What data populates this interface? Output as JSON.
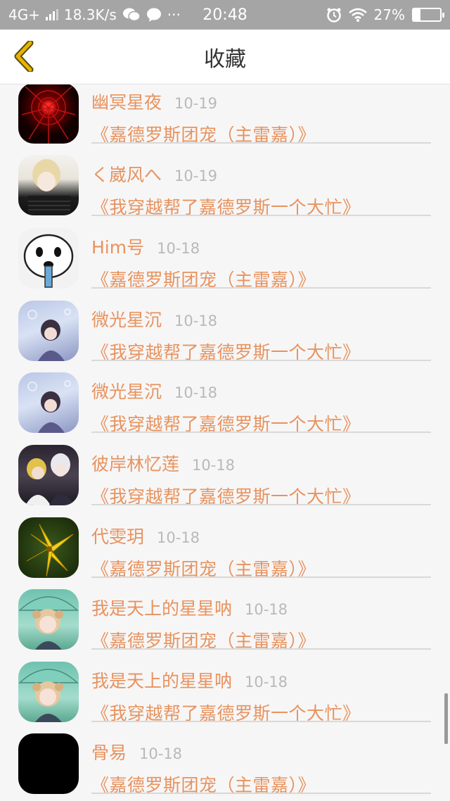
{
  "status_bar": {
    "network": "4G+",
    "speed": "18.3K/s",
    "more": "···",
    "time": "20:48",
    "battery": "27%",
    "battery_level": 0.27
  },
  "nav": {
    "title": "收藏"
  },
  "favorites": [
    {
      "user": "幽冥星夜",
      "date": "10-19",
      "book": "《嘉德罗斯团宠（主雷嘉）》",
      "avatar": "red-web-avatar"
    },
    {
      "user": "く崴风へ",
      "date": "10-19",
      "book": "《我穿越帮了嘉德罗斯一个大忙》",
      "avatar": "anime-boy-avatar"
    },
    {
      "user": "Him号",
      "date": "10-18",
      "book": "《嘉德罗斯团宠（主雷嘉）》",
      "avatar": "meme-face-avatar"
    },
    {
      "user": "微光星沉",
      "date": "10-18",
      "book": "《我穿越帮了嘉德罗斯一个大忙》",
      "avatar": "anime-girl-avatar"
    },
    {
      "user": "微光星沉",
      "date": "10-18",
      "book": "《我穿越帮了嘉德罗斯一个大忙》",
      "avatar": "anime-girl-avatar"
    },
    {
      "user": "彼岸林忆莲",
      "date": "10-18",
      "book": "《我穿越帮了嘉德罗斯一个大忙》",
      "avatar": "anime-duo-avatar"
    },
    {
      "user": "代雯玥",
      "date": "10-18",
      "book": "《嘉德罗斯团宠（主雷嘉）》",
      "avatar": "lily-flower-avatar"
    },
    {
      "user": "我是天上的星星呐",
      "date": "10-18",
      "book": "《嘉德罗斯团宠（主雷嘉）》",
      "avatar": "umbrella-girl-avatar"
    },
    {
      "user": "我是天上的星星呐",
      "date": "10-18",
      "book": "《我穿越帮了嘉德罗斯一个大忙》",
      "avatar": "umbrella-girl-avatar"
    },
    {
      "user": "骨易",
      "date": "10-18",
      "book": "《嘉德罗斯团宠（主雷嘉）》",
      "avatar": "black-avatar"
    }
  ],
  "colors": {
    "accent": "#e7935f",
    "date": "#b9b9b9",
    "status_bar": "#a6a5a5",
    "back_icon": "#e6b400"
  }
}
